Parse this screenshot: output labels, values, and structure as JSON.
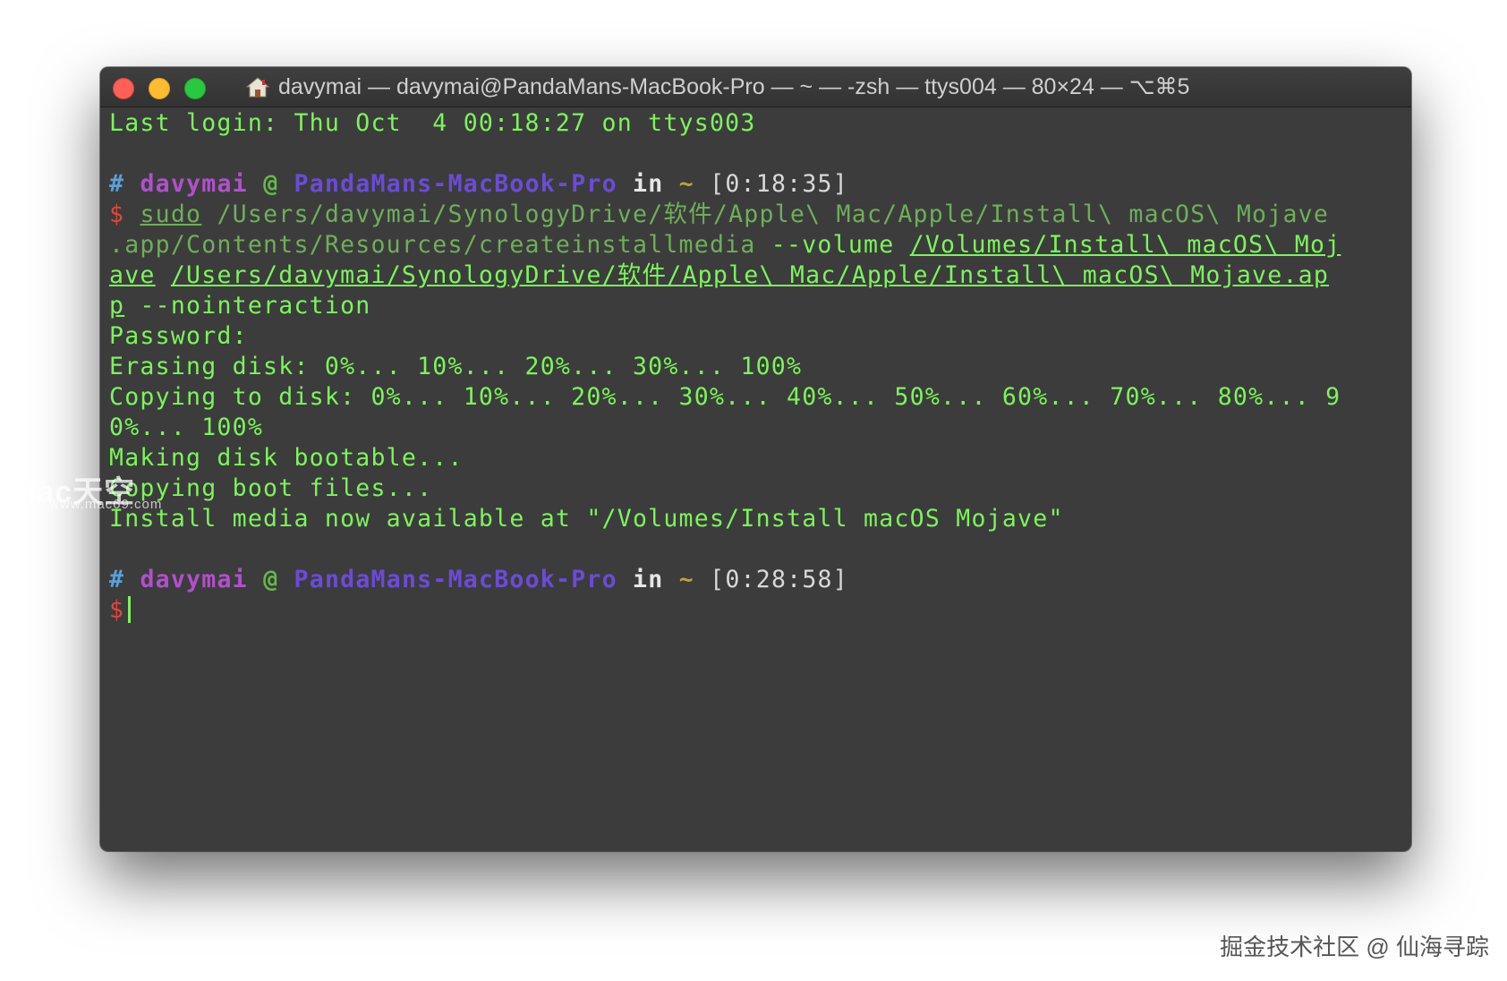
{
  "window": {
    "title": "davymai — davymai@PandaMans-MacBook-Pro — ~ — -zsh — ttys004 — 80×24 — ⌥⌘5",
    "title_icon": "home-icon"
  },
  "terminal": {
    "last_login": "Last login: Thu Oct  4 00:18:27 on ttys003",
    "prompt1": {
      "hash": "#",
      "user": "davymai",
      "at": "@",
      "host": "PandaMans-MacBook-Pro",
      "in": "in",
      "dir": "~",
      "time": "[0:18:35]"
    },
    "cmd": {
      "dollar": "$",
      "sudo": "sudo",
      "line1_rest": " /Users/davymai/SynologyDrive/软件/Apple\\ Mac/Apple/Install\\ macOS\\ Mojave",
      "line2_dim": ".app/Contents/Resources/createinstallmedia",
      "line2_opt": " --volume ",
      "line2_path": "/Volumes/Install\\ macOS\\ Moj",
      "line3_path1": "ave",
      "line3_path2": "/Users/davymai/SynologyDrive/软件/Apple\\ Mac/Apple/Install\\ macOS\\ Mojave.ap",
      "line4_path": "p",
      "line4_opt": " --nointeraction"
    },
    "output": [
      "Password:",
      "Erasing disk: 0%... 10%... 20%... 30%... 100%",
      "Copying to disk: 0%... 10%... 20%... 30%... 40%... 50%... 60%... 70%... 80%... 9",
      "0%... 100%",
      "Making disk bootable...",
      "Copying boot files...",
      "Install media now available at \"/Volumes/Install macOS Mojave\""
    ],
    "prompt2": {
      "hash": "#",
      "user": "davymai",
      "at": "@",
      "host": "PandaMans-MacBook-Pro",
      "in": "in",
      "dir": "~",
      "time": "[0:28:58]"
    },
    "prompt_dollar": "$"
  },
  "watermark": {
    "brand": "Mac天空",
    "url": "www.mac69.com"
  },
  "credit": "掘金技术社区 @ 仙海寻踪",
  "colors": {
    "terminal_bg": "#3c3c3c",
    "text_green": "#7cf45c",
    "user_purple": "#b050cc",
    "host_blue": "#6b4bd8",
    "dollar_red": "#e0483a"
  }
}
